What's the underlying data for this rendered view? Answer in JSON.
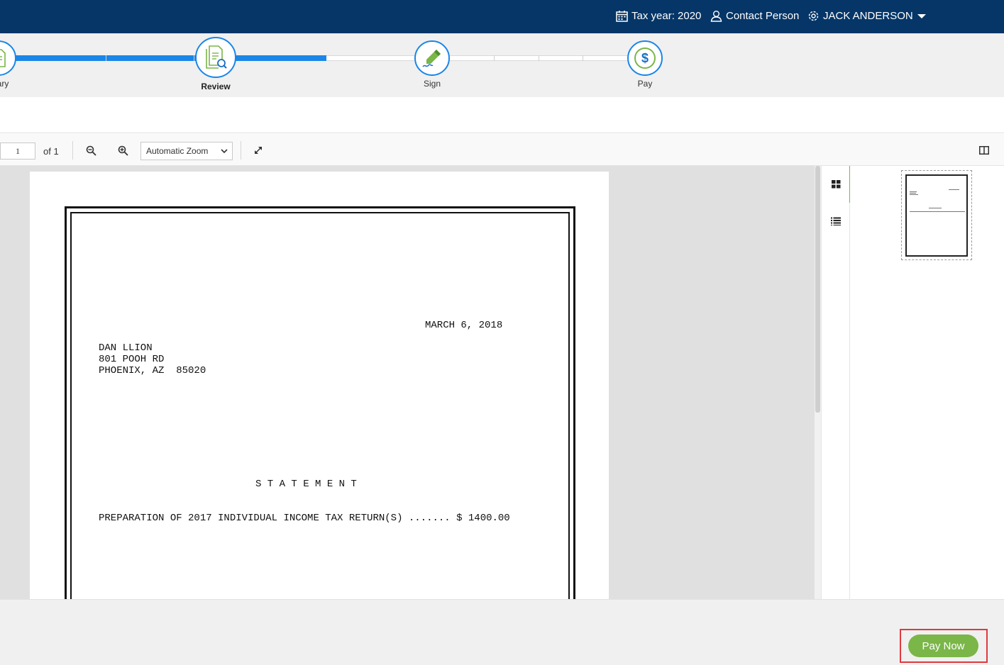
{
  "header": {
    "tax_year": "Tax year: 2020",
    "contact": "Contact Person",
    "user": "JACK ANDERSON"
  },
  "stepper": {
    "steps": [
      {
        "label": "mary",
        "state": "complete"
      },
      {
        "label": "Review",
        "state": "active"
      },
      {
        "label": "Sign",
        "state": "upcoming"
      },
      {
        "label": "Pay",
        "state": "upcoming"
      }
    ],
    "progress_color": "#1a86e8"
  },
  "toolbar": {
    "page_number": "1",
    "page_of": "of 1",
    "zoom_value": "Automatic Zoom"
  },
  "document": {
    "date": "MARCH 6, 2018",
    "address_line1": "DAN LLION",
    "address_line2": "801 POOH RD",
    "address_line3": "PHOENIX, AZ  85020",
    "heading": "S T A T E M E N T",
    "line_item": "PREPARATION OF 2017 INDIVIDUAL INCOME TAX RETURN(S) ....... $ 1400.00"
  },
  "footer": {
    "pay_label": "Pay Now",
    "accent": "#7ab648",
    "highlight": "#e0393e"
  },
  "colors": {
    "topbar": "#053667"
  }
}
